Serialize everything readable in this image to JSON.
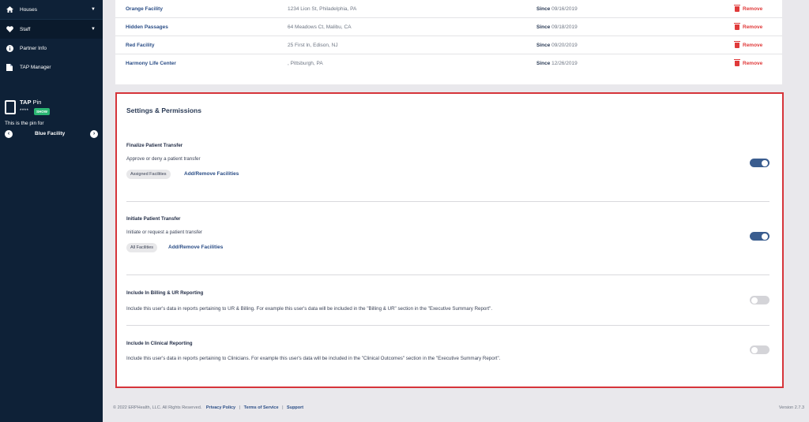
{
  "sidebar": {
    "items": [
      {
        "label": "Houses",
        "icon": "home-icon",
        "has_chevron": true
      },
      {
        "label": "Staff",
        "icon": "heart-icon",
        "has_chevron": true
      },
      {
        "label": "Partner Info",
        "icon": "info-icon",
        "has_chevron": false
      },
      {
        "label": "TAP Manager",
        "icon": "document-icon",
        "has_chevron": false
      }
    ],
    "pin": {
      "title_bold": "TAP",
      "title_rest": " Pin",
      "masked": "****",
      "show_label": "SHOW",
      "for_text": "This is the pin for",
      "facility": "Blue Facility"
    }
  },
  "facilities": [
    {
      "name": "Orange Facility",
      "address": "1234 Lion St, Philadelphia, PA",
      "since_label": "Since",
      "since_date": "09/16/2019",
      "remove": "Remove"
    },
    {
      "name": "Hidden Passages",
      "address": "64 Meadows Ct, Malibu, CA",
      "since_label": "Since",
      "since_date": "09/18/2019",
      "remove": "Remove"
    },
    {
      "name": "Red Facility",
      "address": "25 First ln, Edison, NJ",
      "since_label": "Since",
      "since_date": "09/20/2019",
      "remove": "Remove"
    },
    {
      "name": "Harmony Life Center",
      "address": ", Pittsburgh, PA",
      "since_label": "Since",
      "since_date": "12/26/2019",
      "remove": "Remove"
    }
  ],
  "settings": {
    "title": "Settings & Permissions",
    "permissions": [
      {
        "title": "Finalize Patient Transfer",
        "description": "Approve or deny a patient transfer",
        "pill": "Assigned Facilities",
        "link": "Add/Remove Facilities",
        "enabled": true
      },
      {
        "title": "Initiate Patient Transfer",
        "description": "Initiate or request a patient transfer",
        "pill": "All Facilities",
        "link": "Add/Remove Facilities",
        "enabled": true
      },
      {
        "title": "Include In Billing & UR Reporting",
        "description": "Include this user's data in reports pertaining to UR & Billing. For example this user's data will be included in the \"Billing & UR\" section in the \"Executive Summary Report\".",
        "enabled": false
      },
      {
        "title": "Include In Clinical Reporting",
        "description": "Include this user's data in reports pertaining to Clinicians. For example this user's data will be included in the \"Clinical Outcomes\" section in the \"Executive Summary Report\".",
        "enabled": false
      }
    ]
  },
  "footer": {
    "copyright": "© 2022 ERPHealth, LLC. All Rights Reserved.",
    "privacy": "Privacy Policy",
    "terms": "Terms of Service",
    "support": "Support",
    "separator": "|",
    "version": "Version 2.7.3"
  },
  "colors": {
    "sidebar_bg": "#0e2137",
    "accent_link": "#2a4d86",
    "remove_red": "#e03a3a",
    "highlight_border": "#d6343a",
    "toggle_on": "#3a5d8f",
    "show_badge": "#2bb673"
  }
}
